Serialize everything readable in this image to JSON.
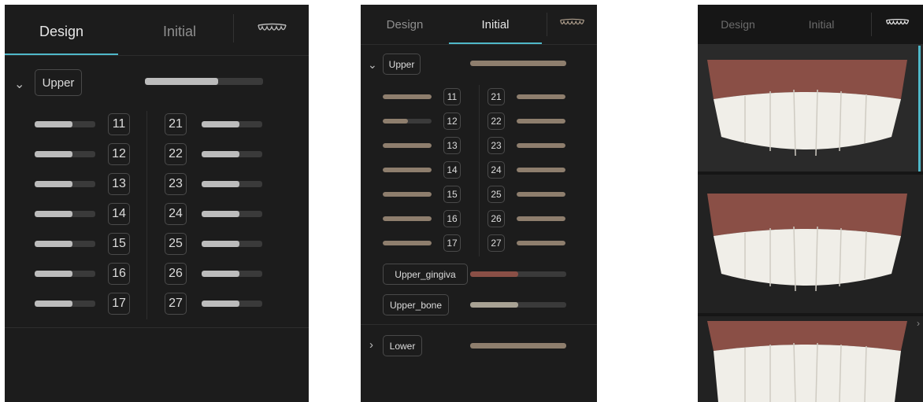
{
  "colors": {
    "accent": "#4fb8c9",
    "panel_bg": "#1c1c1c",
    "fill_gray": "#bcbcbc",
    "fill_tan": "#8e7e6d",
    "gum": "#8a4f46"
  },
  "tabs": [
    {
      "label": "Design"
    },
    {
      "label": "Initial"
    }
  ],
  "tooth_icon": "teeth-icon",
  "panel1": {
    "active_tab": "Design",
    "arch_label": "Upper",
    "arch_level": 0.62,
    "left_teeth": [
      {
        "num": "11",
        "level": 0.62
      },
      {
        "num": "12",
        "level": 0.62
      },
      {
        "num": "13",
        "level": 0.62
      },
      {
        "num": "14",
        "level": 0.62
      },
      {
        "num": "15",
        "level": 0.62
      },
      {
        "num": "16",
        "level": 0.62
      },
      {
        "num": "17",
        "level": 0.62
      }
    ],
    "right_teeth": [
      {
        "num": "21",
        "level": 0.62
      },
      {
        "num": "22",
        "level": 0.62
      },
      {
        "num": "23",
        "level": 0.62
      },
      {
        "num": "24",
        "level": 0.62
      },
      {
        "num": "25",
        "level": 0.62
      },
      {
        "num": "26",
        "level": 0.62
      },
      {
        "num": "27",
        "level": 0.62
      }
    ]
  },
  "panel2": {
    "active_tab": "Initial",
    "arch_label": "Upper",
    "arch_level": 1.0,
    "left_teeth": [
      {
        "num": "11",
        "level": 1.0
      },
      {
        "num": "12",
        "level": 0.52
      },
      {
        "num": "13",
        "level": 1.0
      },
      {
        "num": "14",
        "level": 1.0
      },
      {
        "num": "15",
        "level": 1.0
      },
      {
        "num": "16",
        "level": 1.0
      },
      {
        "num": "17",
        "level": 1.0
      }
    ],
    "right_teeth": [
      {
        "num": "21",
        "level": 1.0
      },
      {
        "num": "22",
        "level": 1.0
      },
      {
        "num": "23",
        "level": 1.0
      },
      {
        "num": "24",
        "level": 1.0
      },
      {
        "num": "25",
        "level": 1.0
      },
      {
        "num": "26",
        "level": 1.0
      },
      {
        "num": "27",
        "level": 1.0
      }
    ],
    "gingiva_label": "Upper_gingiva",
    "gingiva_level": 0.5,
    "bone_label": "Upper_bone",
    "bone_level": 0.5,
    "lower_label": "Lower",
    "lower_level": 1.0
  },
  "panel3": {
    "active_tab": "teeth",
    "previews": [
      {
        "name": "smile-preview-1"
      },
      {
        "name": "smile-preview-2"
      },
      {
        "name": "smile-preview-3"
      }
    ]
  }
}
